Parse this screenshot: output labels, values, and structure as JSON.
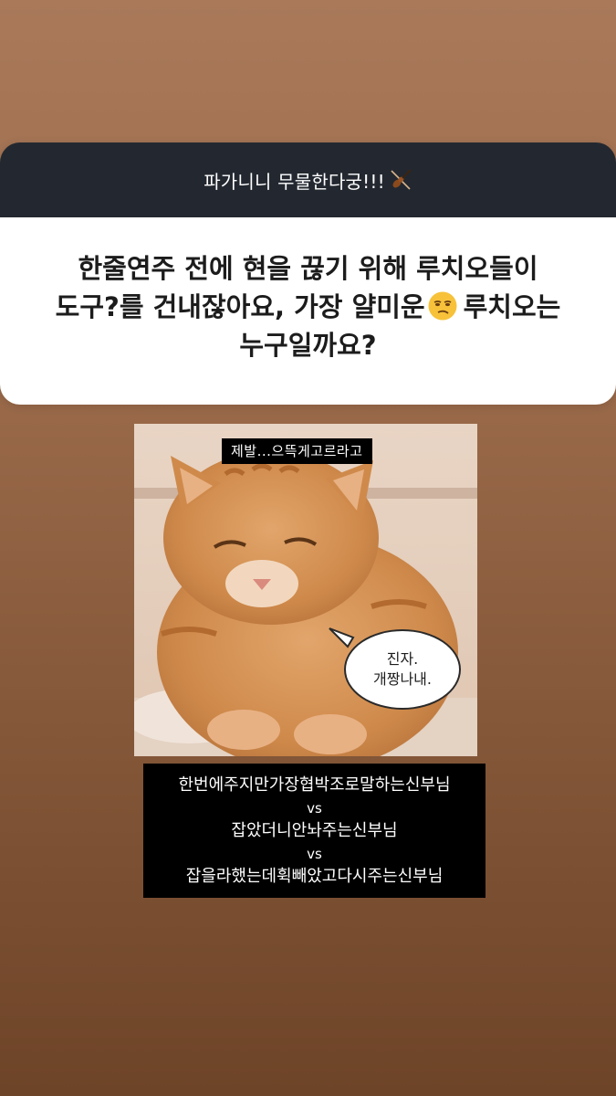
{
  "question_sticker": {
    "header": "파가니니 무물한다궁!!!",
    "header_icon": "violin-icon",
    "question": "한줄연주 전에 현을 끊기 위해 루치오들이\n도구?를 건내잖아요, 가장 얄미운",
    "question_tail": "루치오는\n누구일까요?",
    "question_emoji": "unamused-face-icon"
  },
  "photo": {
    "top_caption": "제발...으뜩게고르라고",
    "bubble_line1": "진자.",
    "bubble_line2": "개짱나내."
  },
  "options": {
    "option1": "한번에주지만가장협박조로말하는신부님",
    "separator1": "vs",
    "option2": "잡았더니안놔주는신부님",
    "separator2": "vs",
    "option3": "잡을라했는데휙빼았고다시주는신부님"
  },
  "colors": {
    "header_bg": "#232830",
    "card_bg": "#ffffff",
    "caption_bg": "#000000"
  }
}
